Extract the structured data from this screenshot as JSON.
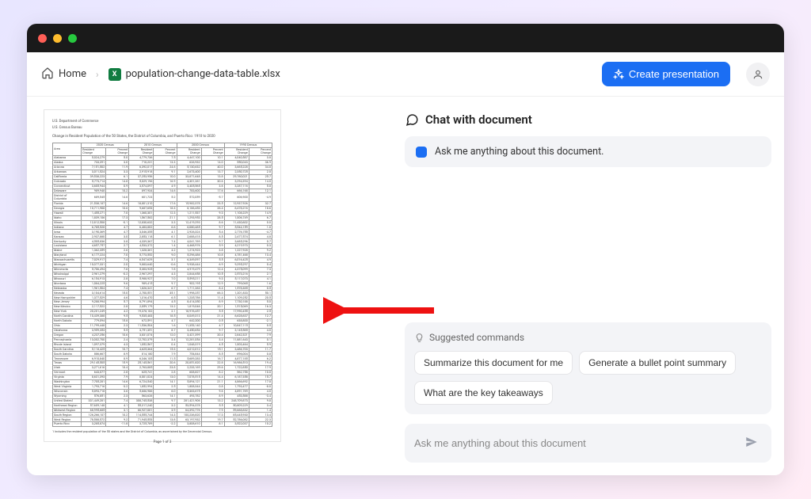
{
  "breadcrumb": {
    "home": "Home",
    "filename": "population-change-data-table.xlsx"
  },
  "toolbar": {
    "create_presentation": "Create presentation"
  },
  "chat": {
    "title": "Chat with document",
    "intro": "Ask me anything about this document.",
    "suggested_head": "Suggested commands",
    "suggested": [
      "Summarize this document for me",
      "Generate a bullet point summary",
      "What are the key takeaways"
    ],
    "input_placeholder": "Ask me anything about this document"
  },
  "document": {
    "dept1": "U.S. Department of Commerce",
    "dept2": "U.S. Census Bureau",
    "title": "Change in Resident Population of the 50 States, the District of Columbia, and Puerto Rico: 1910 to 2020",
    "group_headers": [
      "2020 Census",
      "2010 Census",
      "2000 Census",
      "1990 Census"
    ],
    "sub_headers": [
      "Area",
      "Resident Change",
      "Percent Change",
      "Resident Change",
      "Percent Change",
      "Resident Change",
      "Percent Change",
      "Resident Change",
      "Percent Change"
    ],
    "footnote": "1 Includes the resident population of the 50 states and the District of Columbia, as ascertained by the Decennial Census.",
    "page_label": "Page 1 of 3",
    "rows": [
      [
        "Alabama",
        "5,024,279",
        "5.0",
        "4,779,736",
        "7.5",
        "4,447,100",
        "10.1",
        "4,040,587",
        "3.8"
      ],
      [
        "Alaska",
        "733,391",
        "3.0",
        "710,231",
        "13.3",
        "626,932",
        "14.0",
        "550,043",
        "36.9"
      ],
      [
        "Arizona",
        "7,151,502",
        "11.9",
        "6,392,017",
        "24.6",
        "5,130,632",
        "40.0",
        "3,665,228",
        "34.8"
      ],
      [
        "Arkansas",
        "3,011,524",
        "3.3",
        "2,915,918",
        "9.1",
        "2,673,400",
        "13.7",
        "2,350,725",
        "2.8"
      ],
      [
        "California",
        "39,538,223",
        "6.1",
        "37,253,956",
        "10.0",
        "33,871,648",
        "13.8",
        "29,760,021",
        "25.7"
      ],
      [
        "Colorado",
        "5,773,714",
        "14.8",
        "5,029,196",
        "16.9",
        "4,301,261",
        "30.6",
        "3,294,394",
        "14.0"
      ],
      [
        "Connecticut",
        "3,605,944",
        "0.9",
        "3,574,097",
        "4.9",
        "3,405,565",
        "3.6",
        "3,287,116",
        "5.8"
      ],
      [
        "Delaware",
        "989,948",
        "10.2",
        "897,934",
        "14.6",
        "783,600",
        "17.6",
        "666,168",
        "12.1"
      ],
      [
        "District of Columbia",
        "689,545",
        "14.6",
        "601,723",
        "5.2",
        "572,059",
        "-5.7",
        "606,900",
        "-4.9"
      ],
      [
        "Florida",
        "21,538,187",
        "14.6",
        "18,801,310",
        "17.6",
        "15,982,378",
        "23.5",
        "12,937,926",
        "32.7"
      ],
      [
        "Georgia",
        "10,711,908",
        "10.6",
        "9,687,653",
        "18.3",
        "8,186,453",
        "26.4",
        "6,478,216",
        "18.6"
      ],
      [
        "Hawaii",
        "1,455,271",
        "7.0",
        "1,360,301",
        "12.3",
        "1,211,537",
        "9.3",
        "1,108,229",
        "14.9"
      ],
      [
        "Idaho",
        "1,839,106",
        "17.3",
        "1,567,582",
        "21.1",
        "1,293,953",
        "28.5",
        "1,006,749",
        "6.7"
      ],
      [
        "Illinois",
        "12,812,508",
        "-0.1",
        "12,830,632",
        "3.3",
        "12,419,293",
        "8.6",
        "11,430,602",
        "0.0"
      ],
      [
        "Indiana",
        "6,785,528",
        "4.7",
        "6,483,802",
        "6.6",
        "6,080,485",
        "9.7",
        "5,544,159",
        "1.0"
      ],
      [
        "Iowa",
        "3,190,369",
        "4.7",
        "3,046,355",
        "4.1",
        "2,926,324",
        "5.4",
        "2,776,755",
        "-4.7"
      ],
      [
        "Kansas",
        "2,937,880",
        "3.0",
        "2,853,118",
        "6.1",
        "2,688,418",
        "8.5",
        "2,477,574",
        "4.8"
      ],
      [
        "Kentucky",
        "4,505,836",
        "3.8",
        "4,339,367",
        "7.4",
        "4,041,769",
        "9.7",
        "3,685,296",
        "0.7"
      ],
      [
        "Louisiana",
        "4,657,757",
        "2.7",
        "4,533,372",
        "1.4",
        "4,468,976",
        "5.9",
        "4,219,973",
        "0.3"
      ],
      [
        "Maine",
        "1,362,359",
        "2.6",
        "1,328,361",
        "4.2",
        "1,274,923",
        "3.8",
        "1,227,928",
        "9.2"
      ],
      [
        "Maryland",
        "6,177,224",
        "7.0",
        "5,773,552",
        "9.0",
        "5,296,486",
        "10.8",
        "4,781,468",
        "13.4"
      ],
      [
        "Massachusetts",
        "7,029,917",
        "7.4",
        "6,547,629",
        "3.1",
        "6,349,097",
        "5.5",
        "6,016,425",
        "4.9"
      ],
      [
        "Michigan",
        "10,077,331",
        "2.0",
        "9,883,640",
        "-0.6",
        "9,938,444",
        "6.9",
        "9,295,297",
        "0.4"
      ],
      [
        "Minnesota",
        "5,706,494",
        "7.6",
        "5,303,925",
        "7.8",
        "4,919,479",
        "12.4",
        "4,375,099",
        "7.3"
      ],
      [
        "Mississippi",
        "2,961,279",
        "-0.2",
        "2,967,297",
        "4.3",
        "2,844,658",
        "10.5",
        "2,573,216",
        "2.1"
      ],
      [
        "Missouri",
        "6,154,913",
        "2.8",
        "5,988,927",
        "7.0",
        "5,595,211",
        "9.3",
        "5,117,073",
        "4.1"
      ],
      [
        "Montana",
        "1,084,225",
        "9.6",
        "989,415",
        "9.7",
        "902,195",
        "12.9",
        "799,065",
        "1.6"
      ],
      [
        "Nebraska",
        "1,961,504",
        "7.4",
        "1,826,341",
        "6.7",
        "1,711,263",
        "8.4",
        "1,578,385",
        "0.5"
      ],
      [
        "Nevada",
        "3,104,614",
        "15.0",
        "2,700,551",
        "35.1",
        "1,998,257",
        "66.3",
        "1,201,833",
        "50.1"
      ],
      [
        "New Hampshire",
        "1,377,529",
        "4.6",
        "1,316,470",
        "6.5",
        "1,235,786",
        "11.4",
        "1,109,252",
        "20.5"
      ],
      [
        "New Jersey",
        "9,288,994",
        "5.7",
        "8,791,894",
        "4.5",
        "8,414,350",
        "8.9",
        "7,730,188",
        "5.0"
      ],
      [
        "New Mexico",
        "2,117,522",
        "2.8",
        "2,059,179",
        "13.2",
        "1,819,046",
        "20.1",
        "1,515,069",
        "16.3"
      ],
      [
        "New York",
        "20,201,249",
        "4.2",
        "19,378,102",
        "2.1",
        "18,976,457",
        "5.5",
        "17,990,455",
        "2.5"
      ],
      [
        "North Carolina",
        "10,439,388",
        "9.5",
        "9,535,483",
        "18.5",
        "8,049,313",
        "21.4",
        "6,628,637",
        "12.7"
      ],
      [
        "North Dakota",
        "779,094",
        "15.8",
        "672,591",
        "4.7",
        "642,200",
        "0.5",
        "638,800",
        "-2.1"
      ],
      [
        "Ohio",
        "11,799,448",
        "2.3",
        "11,536,504",
        "1.6",
        "11,353,140",
        "4.7",
        "10,847,115",
        "0.5"
      ],
      [
        "Oklahoma",
        "3,959,353",
        "5.5",
        "3,751,351",
        "8.7",
        "3,450,654",
        "9.7",
        "3,145,585",
        "4.0"
      ],
      [
        "Oregon",
        "4,237,256",
        "10.6",
        "3,831,074",
        "12.0",
        "3,421,399",
        "20.4",
        "2,842,321",
        "7.9"
      ],
      [
        "Pennsylvania",
        "13,002,700",
        "2.4",
        "12,702,379",
        "3.4",
        "12,281,054",
        "3.4",
        "11,881,643",
        "0.1"
      ],
      [
        "Rhode Island",
        "1,097,379",
        "4.3",
        "1,052,567",
        "0.4",
        "1,048,319",
        "4.5",
        "1,003,464",
        "5.9"
      ],
      [
        "South Carolina",
        "5,118,425",
        "10.7",
        "4,625,364",
        "15.3",
        "4,012,012",
        "15.1",
        "3,486,703",
        "11.7"
      ],
      [
        "South Dakota",
        "886,667",
        "8.9",
        "814,180",
        "7.9",
        "754,844",
        "8.5",
        "696,004",
        "0.8"
      ],
      [
        "Tennessee",
        "6,910,840",
        "8.9",
        "6,346,105",
        "11.5",
        "5,689,283",
        "16.7",
        "4,877,185",
        "6.2"
      ],
      [
        "Texas",
        "29,145,505",
        "15.9",
        "25,145,561",
        "20.6",
        "20,851,820",
        "22.8",
        "16,986,510",
        "19.4"
      ],
      [
        "Utah",
        "3,271,616",
        "18.4",
        "2,763,885",
        "23.8",
        "2,233,169",
        "29.6",
        "1,722,850",
        "17.9"
      ],
      [
        "Vermont",
        "643,077",
        "2.8",
        "625,741",
        "2.8",
        "608,827",
        "8.2",
        "562,758",
        "10.0"
      ],
      [
        "Virginia",
        "8,631,393",
        "7.9",
        "8,001,024",
        "13.0",
        "7,078,515",
        "14.4",
        "6,187,358",
        "15.7"
      ],
      [
        "Washington",
        "7,705,281",
        "14.6",
        "6,724,540",
        "14.1",
        "5,894,121",
        "21.1",
        "4,866,692",
        "17.8"
      ],
      [
        "West Virginia",
        "1,793,716",
        "-3.2",
        "1,852,994",
        "2.5",
        "1,808,344",
        "0.8",
        "1,793,477",
        "-8.0"
      ],
      [
        "Wisconsin",
        "5,893,718",
        "3.6",
        "5,686,986",
        "6.0",
        "5,363,675",
        "9.6",
        "4,891,769",
        "4.0"
      ],
      [
        "Wyoming",
        "576,851",
        "2.3",
        "563,626",
        "14.1",
        "493,782",
        "8.9",
        "453,588",
        "-3.4"
      ],
      [
        "United States1",
        "331,449,281",
        "7.4",
        "308,745,538",
        "9.7",
        "281,421,906",
        "13.2",
        "248,709,873",
        "9.8"
      ],
      [
        "Northeast Region",
        "57,609,148",
        "4.1",
        "55,317,240",
        "3.2",
        "53,594,378",
        "5.5",
        "50,809,229",
        "3.4"
      ],
      [
        "Midwest Region",
        "68,995,685",
        "3.1",
        "66,927,001",
        "3.9",
        "64,392,776",
        "7.9",
        "59,668,632",
        "1.4"
      ],
      [
        "South Region",
        "126,266,107",
        "10.2",
        "114,555,744",
        "14.3",
        "100,236,820",
        "17.3",
        "85,445,930",
        "13.4"
      ],
      [
        "West Region",
        "78,588,572",
        "9.2",
        "71,945,553",
        "13.8",
        "63,197,932",
        "19.7",
        "52,786,082",
        "22.3"
      ],
      [
        "Puerto Rico",
        "3,285,874",
        "-11.8",
        "3,725,789",
        "-2.2",
        "3,808,610",
        "8.1",
        "3,522,037",
        "10.2"
      ]
    ]
  }
}
